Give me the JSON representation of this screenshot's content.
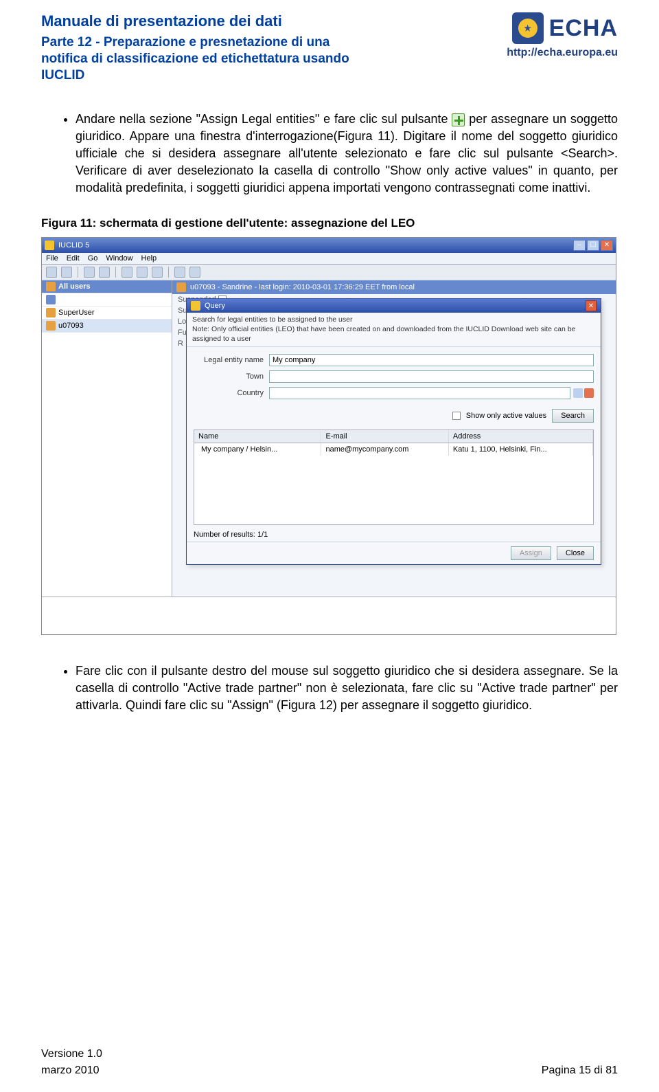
{
  "header": {
    "title": "Manuale di presentazione dei dati",
    "subtitle": "Parte 12 - Preparazione e presnetazione di una notifica di classificazione ed etichettatura usando IUCLID",
    "logo_text": "ECHA",
    "logo_url": "http://echa.europa.eu"
  },
  "bullets": [
    {
      "pre": "Andare nella sezione \"Assign Legal entities\" e fare clic sul pulsante ",
      "post": " per assegnare un soggetto giuridico. Appare una finestra d'interrogazione(Figura 11). Digitare il nome del soggetto giuridico ufficiale che si desidera assegnare all'utente selezionato e fare clic sul pulsante <Search>. Verificare di aver deselezionato la casella di controllo \"Show only active values\" in quanto, per modalità predefinita, i soggetti giuridici appena importati vengono contrassegnati come inattivi.",
      "has_icon": true
    },
    {
      "text": "Fare clic con il pulsante destro del mouse sul soggetto giuridico che si desidera assegnare. Se la casella di controllo \"Active trade partner\" non è selezionata, fare clic su \"Active trade partner\" per attivarla. Quindi fare clic su \"Assign\" (Figura 12) per assegnare il soggetto giuridico."
    }
  ],
  "figure_caption": "Figura 11: schermata di gestione dell'utente: assegnazione del LEO",
  "app": {
    "title": "IUCLID 5",
    "menubar": [
      "File",
      "Edit",
      "Go",
      "Window",
      "Help"
    ],
    "user_panel": {
      "header": "All users",
      "items": [
        "SuperUser",
        "u07093"
      ]
    },
    "main_header": "u07093 - Sandrine - last login: 2010-03-01 17:36:29 EET from local",
    "stub_lines": [
      "Suspended",
      "Sup",
      "Log",
      "Fu",
      "R"
    ],
    "query": {
      "title": "Query",
      "hint_l1": "Search for legal entities to be assigned to the user",
      "hint_l2": "Note: Only official entities (LEO) that have been created on and downloaded from the IUCLID Download web site can be assigned to a user",
      "fields": {
        "name_label": "Legal entity name",
        "name_value": "My company",
        "town_label": "Town",
        "town_value": "",
        "country_label": "Country",
        "country_value": ""
      },
      "show_active_label": "Show only active values",
      "search_btn": "Search",
      "table": {
        "headers": [
          "Name",
          "E-mail",
          "Address"
        ],
        "row": {
          "name": "My company / Helsin...",
          "email": "name@mycompany.com",
          "address": "Katu 1, 1100, Helsinki, Fin..."
        }
      },
      "results_label": "Number of results:",
      "results_value": "1/1",
      "assign_btn": "Assign",
      "close_btn": "Close"
    }
  },
  "footer": {
    "version": "Versione 1.0",
    "page": "Pagina 15 di 81",
    "date": "marzo 2010"
  }
}
